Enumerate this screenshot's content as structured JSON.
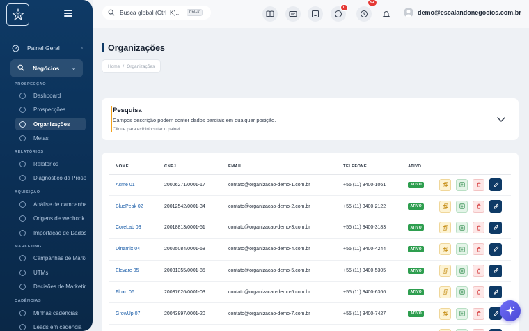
{
  "topbar": {
    "search_placeholder": "Busca global (Ctrl+K)...",
    "search_shortcut": "Ctrl+K",
    "badge_whatsapp": "0",
    "badge_clock": "9+",
    "user_email": "demo@escalandonegocios.com.br",
    "icons": [
      "book-icon",
      "id-card-icon",
      "inbox-icon",
      "whatsapp-icon",
      "clock-icon",
      "bell-icon"
    ]
  },
  "sidebar": {
    "top_items": [
      {
        "label": "Painel Geral"
      },
      {
        "label": "Negócios"
      }
    ],
    "sections": [
      {
        "label": "PROSPECÇÃO",
        "items": [
          "Dashboard",
          "Prospecções",
          "Organizações",
          "Metas"
        ]
      },
      {
        "label": "RELATÓRIOS",
        "items": [
          "Relatórios",
          "Diagnóstico da Prospecção"
        ]
      },
      {
        "label": "AQUISIÇÃO",
        "items": [
          "Análise de campanhas",
          "Origens de webhook",
          "Importação de Dados"
        ]
      },
      {
        "label": "MARKETING",
        "items": [
          "Campanhas de Marketing",
          "UTMs",
          "Decisões de Marketing"
        ]
      },
      {
        "label": "CADÊNCIAS",
        "items": [
          "Minhas cadências",
          "Leads em cadência"
        ]
      }
    ],
    "active_item": "Organizações"
  },
  "page": {
    "title": "Organizações",
    "breadcrumb": [
      "Home",
      "Organizações"
    ]
  },
  "search_panel": {
    "title": "Pesquisa",
    "subtitle": "Campos descrição podem conter dados parciais em qualquer posição.",
    "hint": "Clique para exibir/ocultar o painel"
  },
  "table": {
    "columns": [
      "NOME",
      "CNPJ",
      "EMAIL",
      "TELEFONE",
      "ATIVO"
    ],
    "rows": [
      {
        "nome": "Acme 01",
        "cnpj": "20006271/0001-17",
        "email": "contato@organizacao-demo-1.com.br",
        "telefone": "+55 (11) 3400-1061",
        "ativo": "ATIVO"
      },
      {
        "nome": "BluePeak 02",
        "cnpj": "20012542/0001-34",
        "email": "contato@organizacao-demo-2.com.br",
        "telefone": "+55 (11) 3400-2122",
        "ativo": "ATIVO"
      },
      {
        "nome": "CoreLab 03",
        "cnpj": "20018813/0001-51",
        "email": "contato@organizacao-demo-3.com.br",
        "telefone": "+55 (11) 3400-3183",
        "ativo": "ATIVO"
      },
      {
        "nome": "Dinamix 04",
        "cnpj": "20025084/0001-68",
        "email": "contato@organizacao-demo-4.com.br",
        "telefone": "+55 (11) 3400-4244",
        "ativo": "ATIVO"
      },
      {
        "nome": "Elevare 05",
        "cnpj": "20031355/0001-85",
        "email": "contato@organizacao-demo-5.com.br",
        "telefone": "+55 (11) 3400-5305",
        "ativo": "ATIVO"
      },
      {
        "nome": "Fluxo 06",
        "cnpj": "20037626/0001-03",
        "email": "contato@organizacao-demo-6.com.br",
        "telefone": "+55 (11) 3400-6366",
        "ativo": "ATIVO"
      },
      {
        "nome": "GrowUp 07",
        "cnpj": "20043897/0001-20",
        "email": "contato@organizacao-demo-7.com.br",
        "telefone": "+55 (11) 3400-7427",
        "ativo": "ATIVO"
      },
      {
        "nome": "",
        "cnpj": "",
        "email": "",
        "telefone": "",
        "ativo": ""
      }
    ]
  },
  "colors": {
    "sidebar_bg": "#0e3a66",
    "accent_orange": "#f3a11b",
    "active_green": "#2e9e4f",
    "link_blue": "#1559a6",
    "fab_purple": "#5b58e8"
  }
}
